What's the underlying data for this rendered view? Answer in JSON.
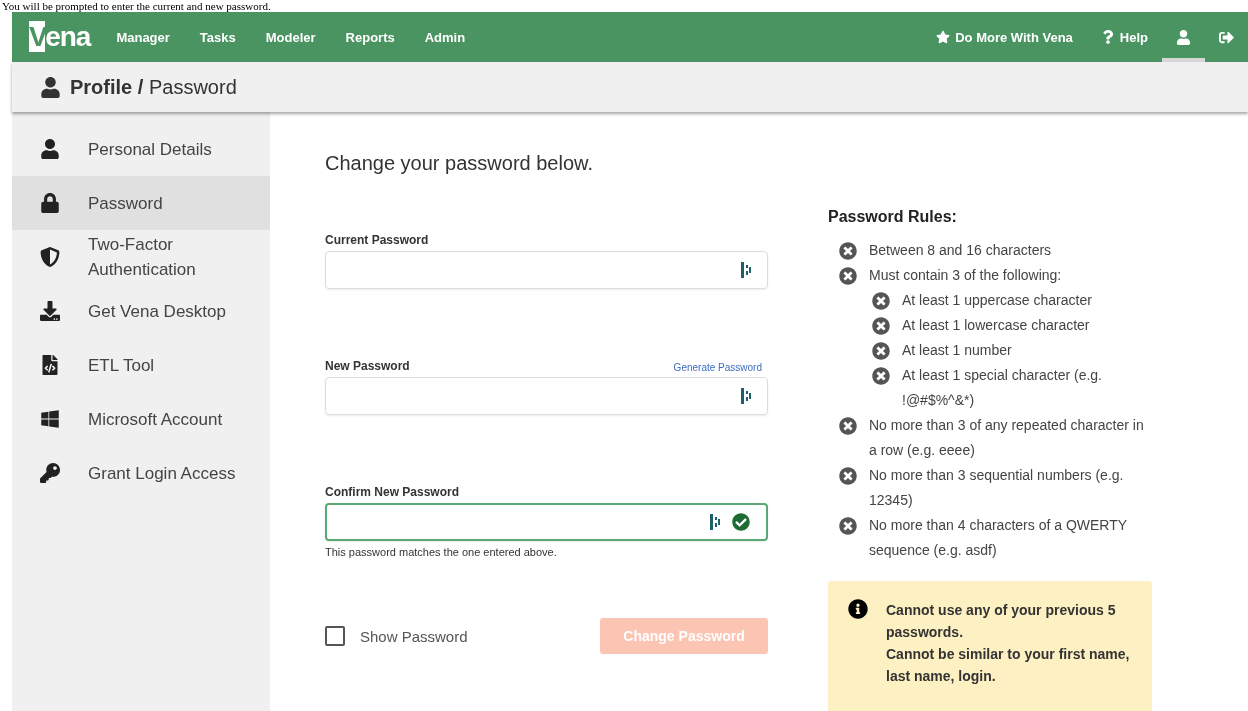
{
  "caption": "You will be prompted to enter the current and new password.",
  "navbar": {
    "logo": "Vena",
    "menu": [
      "Manager",
      "Tasks",
      "Modeler",
      "Reports",
      "Admin"
    ],
    "right": [
      {
        "kind": "star",
        "label": "Do More With Vena",
        "selected": false
      },
      {
        "kind": "help",
        "label": "Help",
        "selected": false
      },
      {
        "kind": "user",
        "selected": true
      },
      {
        "kind": "logout",
        "selected": false
      }
    ]
  },
  "header": {
    "section": "Profile",
    "separator": "/",
    "page": "Password"
  },
  "sidebar": {
    "items": [
      {
        "kind": "user",
        "label": "Personal Details",
        "selected": false
      },
      {
        "kind": "lock",
        "label": "Password",
        "selected": true
      },
      {
        "kind": "shield",
        "label": "Two-Factor Authentication",
        "selected": false
      },
      {
        "kind": "download",
        "label": "Get Vena Desktop",
        "selected": false
      },
      {
        "kind": "file",
        "label": "ETL Tool",
        "selected": false
      },
      {
        "kind": "windows",
        "label": "Microsoft Account",
        "selected": false
      },
      {
        "kind": "key",
        "label": "Grant Login Access",
        "selected": false
      }
    ]
  },
  "form": {
    "title": "Change your password below.",
    "fields": [
      {
        "label": "Current Password",
        "matched": false
      },
      {
        "label": "New Password",
        "link": "Generate Password",
        "matched": false
      },
      {
        "label": "Confirm New Password",
        "matched": true,
        "hint": "This password matches the one entered above."
      }
    ],
    "show_password": {
      "label": "Show Password",
      "checked": false
    },
    "submit": {
      "label": "Change Password",
      "disabled": true
    }
  },
  "rules": {
    "title": "Password Rules:",
    "items": [
      {
        "text": "Between 8 and 16 characters",
        "met": false
      },
      {
        "text": "Must contain 3 of the following:",
        "met": false,
        "children": [
          {
            "text": "At least 1 uppercase character",
            "met": false
          },
          {
            "text": "At least 1 lowercase character",
            "met": false
          },
          {
            "text": "At least 1 number",
            "met": false
          },
          {
            "text": "At least 1 special character (e.g. !@#$%^&*)",
            "met": false
          }
        ]
      },
      {
        "text": "No more than 3 of any repeated character in a row (e.g. eeee)",
        "met": false
      },
      {
        "text": "No more than 3 sequential numbers (e.g. 12345)",
        "met": false
      },
      {
        "text": "No more than 4 characters of a QWERTY sequence (e.g. asdf)",
        "met": false
      }
    ],
    "notice": [
      "Cannot use any of your previous 5 passwords.",
      "Cannot be similar to your first name, last name, login."
    ]
  }
}
